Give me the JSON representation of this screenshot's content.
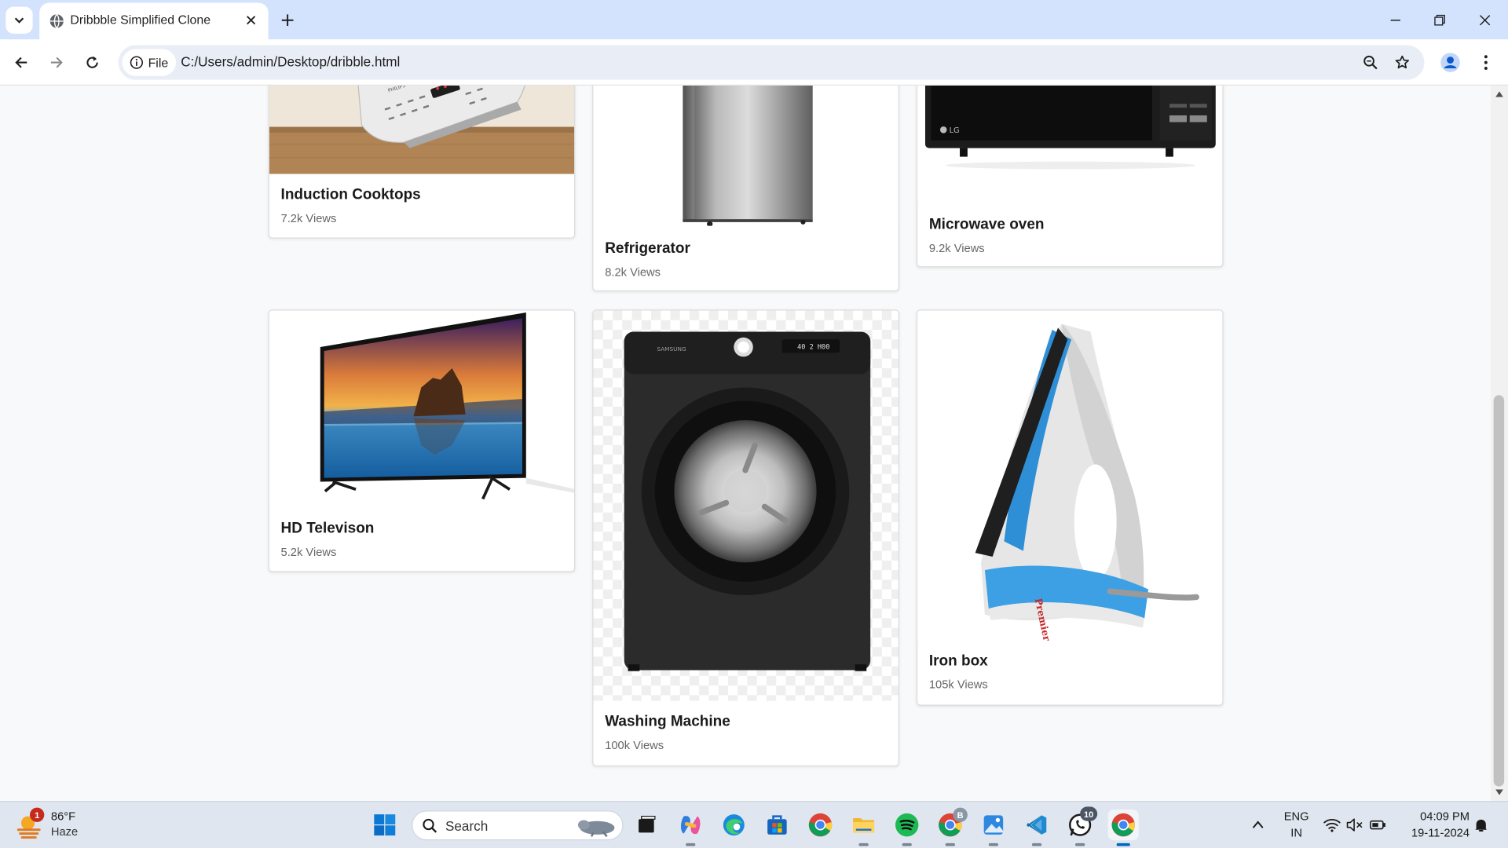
{
  "browser": {
    "tab_title": "Dribbble Simplified Clone",
    "site_chip_label": "File",
    "url": "C:/Users/admin/Desktop/dribble.html"
  },
  "cards": [
    {
      "title": "Induction Cooktops",
      "views": "7.2k Views"
    },
    {
      "title": "Refrigerator",
      "views": "8.2k Views"
    },
    {
      "title": "Microwave oven",
      "views": "9.2k Views"
    },
    {
      "title": "HD Televison",
      "views": "5.2k Views"
    },
    {
      "title": "Washing Machine",
      "views": "100k Views"
    },
    {
      "title": "Iron box",
      "views": "105k Views"
    }
  ],
  "product_marks": {
    "microwave_brand": "LG",
    "washer_brand": "SAMSUNG",
    "washer_display": "40 2 H00",
    "iron_brand": "Premier",
    "cooktop_brand": "PHILIPS"
  },
  "taskbar": {
    "weather_temp": "86°F",
    "weather_condition": "Haze",
    "weather_badge": "1",
    "search_label": "Search",
    "chrome_profile_badge": "B",
    "whatsapp_badge": "10",
    "language_line1": "ENG",
    "language_line2": "IN",
    "time": "04:09 PM",
    "date": "19-11-2024"
  },
  "colors": {
    "titlebar": "#d3e3fd",
    "omnibox": "#e9eef6",
    "page_bg": "#f8f9fa",
    "taskbar": "#dfe6ef",
    "accent": "#0067c0"
  }
}
